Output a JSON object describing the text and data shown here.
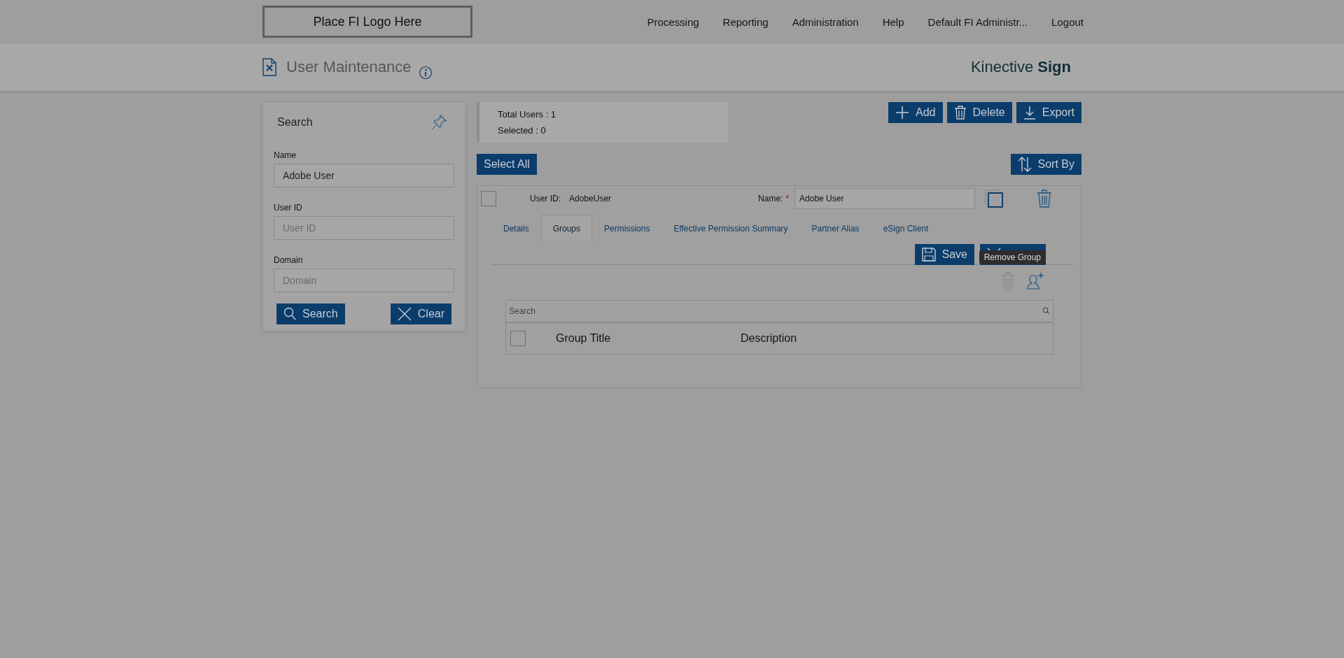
{
  "logo": "Place FI Logo Here",
  "nav": [
    "Processing",
    "Reporting",
    "Administration",
    "Help",
    "Default FI Administr...",
    "Logout"
  ],
  "page": {
    "title": "User Maintenance",
    "brand": "Kinective",
    "brand_bold": "Sign"
  },
  "search_panel": {
    "title": "Search",
    "fields": [
      {
        "label": "Name",
        "value": "Adobe User"
      },
      {
        "label": "User ID",
        "placeholder": "User ID"
      },
      {
        "label": "Domain",
        "placeholder": "Domain"
      }
    ],
    "buttons": [
      {
        "kind": "search",
        "label": "Search"
      },
      {
        "kind": "clear",
        "label": "Clear"
      }
    ]
  },
  "stats": [
    "Total Users : 1",
    "Selected : 0"
  ],
  "actions": [
    {
      "kind": "add",
      "label": "Add"
    },
    {
      "kind": "delete",
      "label": "Delete"
    },
    {
      "kind": "export",
      "label": "Export"
    }
  ],
  "select_all": "Select All",
  "sort_by": "Sort By",
  "record": {
    "checked": false,
    "user_id_label": "User ID:",
    "user_id": "AdobeUser",
    "name_label": "Name:",
    "required_mark": "*",
    "name_value": "Adobe User",
    "tabs": [
      {
        "label": "Details",
        "selected": false
      },
      {
        "label": "Groups",
        "selected": true
      },
      {
        "label": "Permissions",
        "selected": false
      },
      {
        "label": "Effective Permission Summary",
        "selected": false
      },
      {
        "label": "Partner Alias",
        "selected": false
      },
      {
        "label": "eSign Client",
        "selected": false
      }
    ],
    "save": "Save",
    "tooltip": "Remove Group",
    "groups_table": {
      "search_placeholder": "Search",
      "columns": [
        "Group Title",
        "Description"
      ],
      "all_checked": false
    }
  }
}
